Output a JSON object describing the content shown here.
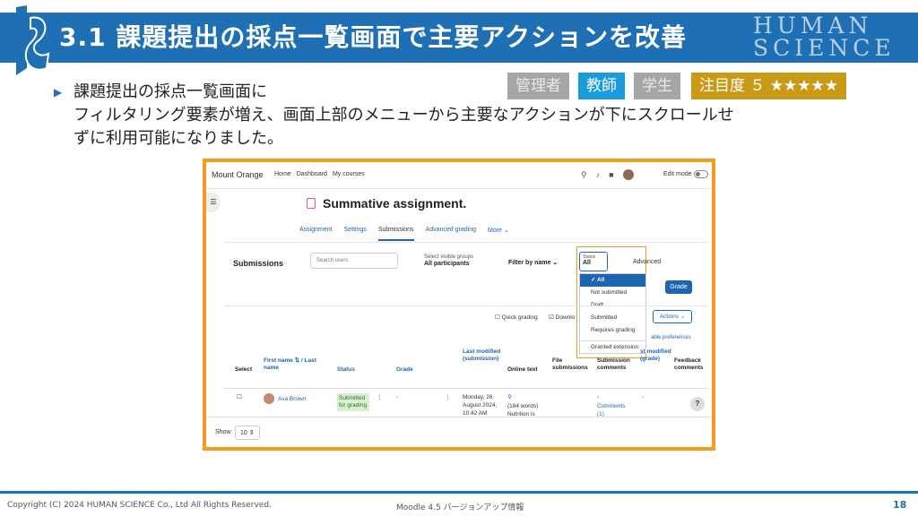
{
  "header": {
    "title": "3.1 課題提出の採点一覧画面で主要アクションを改善",
    "brand_line1": "HUMAN",
    "brand_line2": "SCIENCE",
    "brand_color": "#1f6fb5"
  },
  "description": {
    "line1": "課題提出の採点一覧画面に",
    "line2": "フィルタリング要素が増え、画面上部のメニューから主要なアクションが下にスクロールせ",
    "line3": "ずに利用可能になりました。"
  },
  "tags": {
    "admin": "管理者",
    "teacher": "教師",
    "student": "学生",
    "attention": "注目度 ５ ★★★★★"
  },
  "screenshot": {
    "site_name": "Mount Orange",
    "nav_links": [
      "Home",
      "Dashboard",
      "My courses"
    ],
    "edit_mode": "Edit mode",
    "page_title": "Summative assignment.",
    "tabs": [
      "Assignment",
      "Settings",
      "Submissions",
      "Advanced grading",
      "More ⌄"
    ],
    "submissions_label": "Submissions",
    "search_placeholder": "Search users",
    "group_label": "Select visible groups",
    "group_value": "All participants",
    "filter_by_name": "Filter by name ⌄",
    "status_label": "Status",
    "status_value": "All",
    "advanced": "Advanced",
    "status_options": [
      "✓ All",
      "Not submitted",
      "Draft",
      "Submitted",
      "Requires grading",
      "Granted extension"
    ],
    "grade_button": "Grade",
    "quick_grading": "Quick grading",
    "download": "Downlo",
    "actions_button": "Actions ⌄",
    "preferences": "able preferences",
    "columns": {
      "select": "Select",
      "firstname": "First name ⇅ / Last name",
      "status": "Status",
      "grade": "Grade",
      "last_modified": "Last modified (submission)",
      "online_text": "Online text",
      "file_submissions": "File submissions",
      "submission_comments": "Submission comments",
      "last_modified_grade": "st modified (grade)",
      "feedback_comments": "Feedback comments"
    },
    "row": {
      "name": "Ava Brown",
      "status": "Submitted for grading",
      "grade": "-",
      "date": "Monday, 26 August 2024, 10:42 AM",
      "online_text": "(184 words) Nutrition is",
      "comments": "Comments (1)",
      "last_grade": "-"
    },
    "show_label": "Show",
    "show_value": "10 ⇕"
  },
  "footer": {
    "copyright": "Copyright (C) 2024 HUMAN SCIENCE Co., Ltd All Rights Reserved.",
    "subject": "Moodle 4.5 バージョンアップ情報",
    "page_number": "18"
  }
}
